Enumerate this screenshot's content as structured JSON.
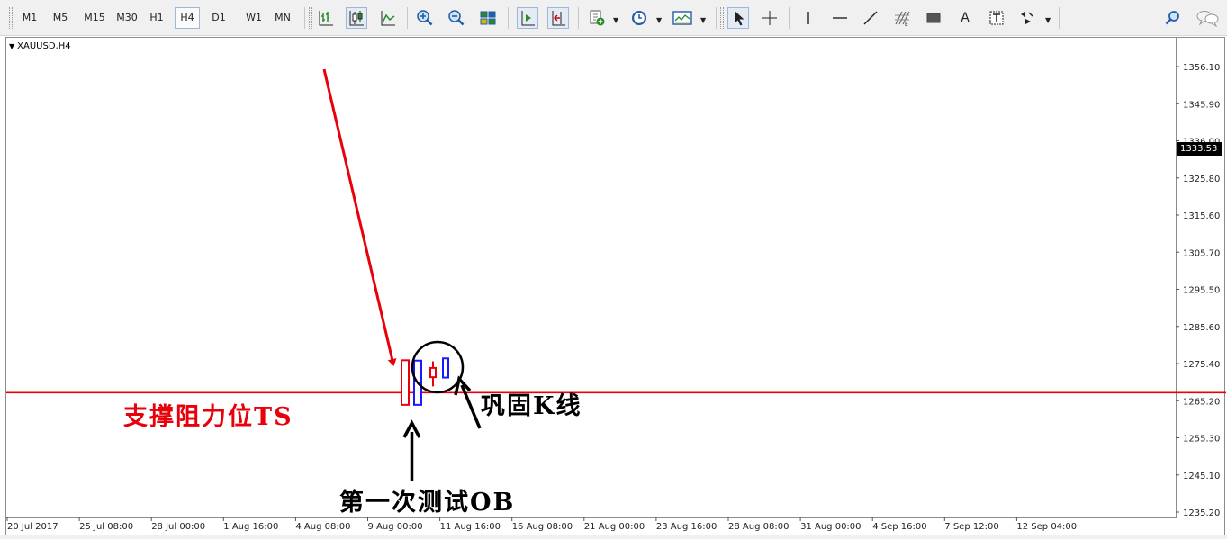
{
  "toolbar": {
    "timeframes": [
      "M1",
      "M5",
      "M15",
      "M30",
      "H1",
      "H4",
      "D1",
      "W1",
      "MN"
    ],
    "active_timeframe": "H4",
    "text_tool_label": "A",
    "icons": [
      "bar-chart-icon",
      "candlestick-icon",
      "line-chart-icon",
      "zoom-in-icon",
      "zoom-out-icon",
      "tile-windows-icon",
      "chart-shift-icon",
      "auto-scroll-icon",
      "indicators-icon",
      "periods-icon",
      "templates-icon",
      "cursor-icon",
      "crosshair-icon",
      "vertical-line-icon",
      "horizontal-line-icon",
      "trendline-icon",
      "fibonacci-icon",
      "rectangle-icon",
      "text-icon",
      "text-label-icon",
      "arrows-icon",
      "search-icon",
      "chat-icon"
    ]
  },
  "chart": {
    "symbol": "XAUUSD,H4",
    "current_price": "1333.53",
    "price_labels": [
      "1356.10",
      "1345.90",
      "1336.00",
      "1325.80",
      "1315.60",
      "1305.70",
      "1295.50",
      "1285.60",
      "1275.40",
      "1265.20",
      "1255.30",
      "1245.10",
      "1235.20"
    ],
    "date_labels": [
      "20 Jul 2017",
      "25 Jul 08:00",
      "28 Jul 00:00",
      "1 Aug 16:00",
      "4 Aug 08:00",
      "9 Aug 00:00",
      "11 Aug 16:00",
      "16 Aug 08:00",
      "21 Aug 00:00",
      "23 Aug 16:00",
      "28 Aug 08:00",
      "31 Aug 00:00",
      "4 Sep 16:00",
      "7 Sep 12:00",
      "12 Sep 04:00"
    ]
  },
  "annotations": {
    "support_resistance": "支撑阻力位TS",
    "first_test": "第一次测试OB",
    "consolidation": "巩固K线"
  },
  "colors": {
    "support_line": "#e8000b",
    "red_arrow": "#e8000b",
    "bear_candle": "#e8000b",
    "bull_candle": "#1a1aff",
    "annotation_red": "#e8000b",
    "annotation_black": "#000000"
  },
  "candles": [
    {
      "type": "bear",
      "open": 1276.4,
      "close": 1264.3,
      "high": 1276.4,
      "low": 1264.3
    },
    {
      "type": "bull",
      "open": 1264.3,
      "close": 1276.3,
      "high": 1276.3,
      "low": 1264.3
    },
    {
      "type": "bear",
      "open": 1274.3,
      "close": 1271.8,
      "high": 1276.1,
      "low": 1269.3
    },
    {
      "type": "bull",
      "open": 1271.7,
      "close": 1276.9,
      "high": 1276.9,
      "low": 1271.7
    }
  ],
  "support_level": 1267.6
}
